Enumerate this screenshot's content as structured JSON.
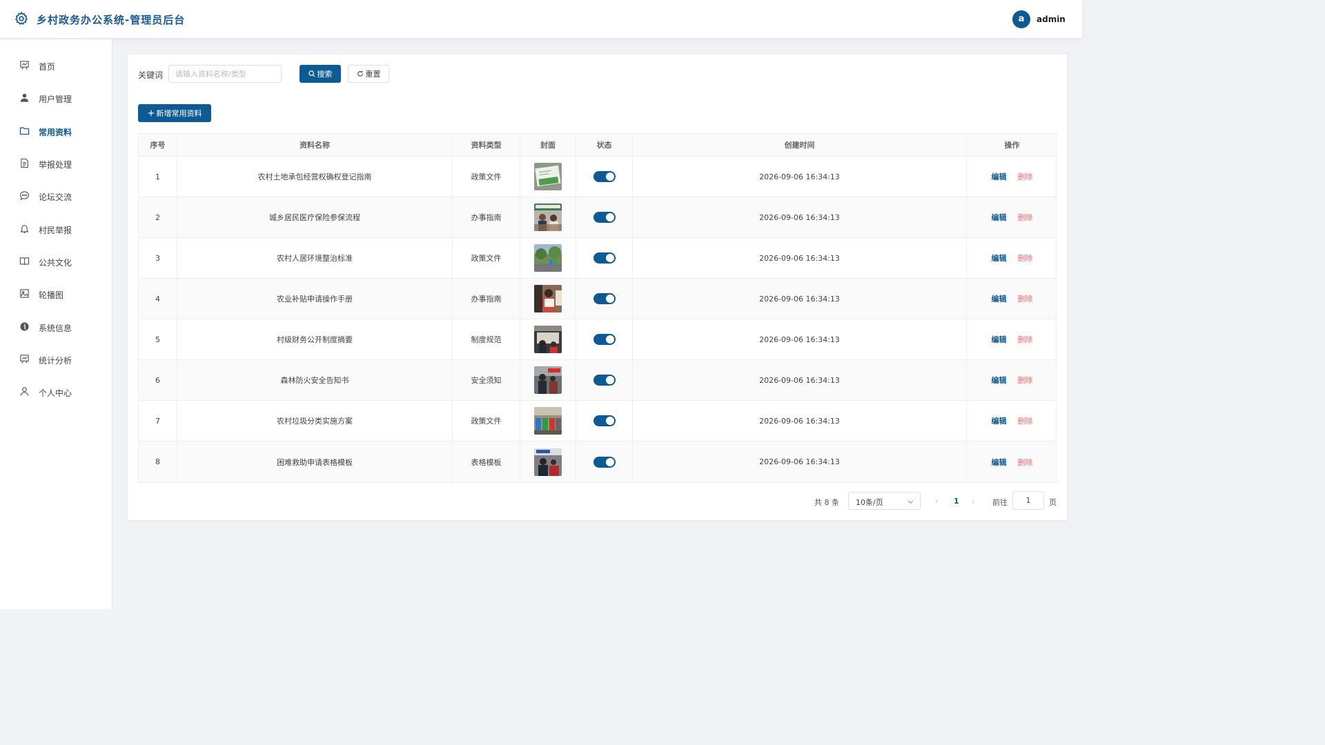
{
  "header": {
    "title": "乡村政务办公系统-管理员后台",
    "avatar_letter": "a",
    "username": "admin"
  },
  "sidebar": {
    "items": [
      {
        "label": "首页",
        "icon": "chart-board-icon",
        "active": false
      },
      {
        "label": "用户管理",
        "icon": "user-icon",
        "active": false
      },
      {
        "label": "常用资料",
        "icon": "folder-icon",
        "active": true
      },
      {
        "label": "举报处理",
        "icon": "document-icon",
        "active": false
      },
      {
        "label": "论坛交流",
        "icon": "chat-icon",
        "active": false
      },
      {
        "label": "村民举报",
        "icon": "bell-icon",
        "active": false
      },
      {
        "label": "公共文化",
        "icon": "book-icon",
        "active": false
      },
      {
        "label": "轮播图",
        "icon": "image-icon",
        "active": false
      },
      {
        "label": "系统信息",
        "icon": "info-icon",
        "active": false
      },
      {
        "label": "统计分析",
        "icon": "chart-board-icon",
        "active": false
      },
      {
        "label": "个人中心",
        "icon": "user-outline-icon",
        "active": false
      }
    ]
  },
  "search": {
    "label": "关键词",
    "placeholder": "请输入资料名称/类型",
    "value": "",
    "search_label": "搜索",
    "reset_label": "重置"
  },
  "toolbar": {
    "add_label": "新增常用资料"
  },
  "table": {
    "columns": [
      "序号",
      "资料名称",
      "资料类型",
      "封面",
      "状态",
      "创建时间",
      "操作"
    ],
    "edit_label": "编辑",
    "delete_label": "删除",
    "rows": [
      {
        "index": "1",
        "name": "农村土地承包经营权确权登记指南",
        "type": "政策文件",
        "status": true,
        "created": "2026-09-06 16:34:13",
        "cover": "document-photo"
      },
      {
        "index": "2",
        "name": "城乡居民医疗保险参保流程",
        "type": "办事指南",
        "status": true,
        "created": "2026-09-06 16:34:13",
        "cover": "service-desk-photo"
      },
      {
        "index": "3",
        "name": "农村人居环境整治标准",
        "type": "政策文件",
        "status": true,
        "created": "2026-09-06 16:34:13",
        "cover": "village-street-photo"
      },
      {
        "index": "4",
        "name": "农业补贴申请操作手册",
        "type": "办事指南",
        "status": true,
        "created": "2026-09-06 16:34:13",
        "cover": "person-with-paper-photo"
      },
      {
        "index": "5",
        "name": "村级财务公开制度摘要",
        "type": "制度规范",
        "status": true,
        "created": "2026-09-06 16:34:13",
        "cover": "notice-board-photo"
      },
      {
        "index": "6",
        "name": "森林防火安全告知书",
        "type": "安全须知",
        "status": true,
        "created": "2026-09-06 16:34:13",
        "cover": "fire-safety-photo"
      },
      {
        "index": "7",
        "name": "农村垃圾分类实施方案",
        "type": "政策文件",
        "status": true,
        "created": "2026-09-06 16:34:13",
        "cover": "garbage-bins-photo"
      },
      {
        "index": "8",
        "name": "困难救助申请表格模板",
        "type": "表格模板",
        "status": true,
        "created": "2026-09-06 16:34:13",
        "cover": "meeting-photo"
      }
    ]
  },
  "pagination": {
    "total_label": "共 8 条",
    "page_size": "10条/页",
    "current_page": "1",
    "goto_prefix": "前往",
    "goto_value": "1",
    "goto_suffix": "页"
  },
  "colors": {
    "primary": "#0d5a94",
    "danger": "#f56c6c",
    "background": "#f0f2f5"
  }
}
